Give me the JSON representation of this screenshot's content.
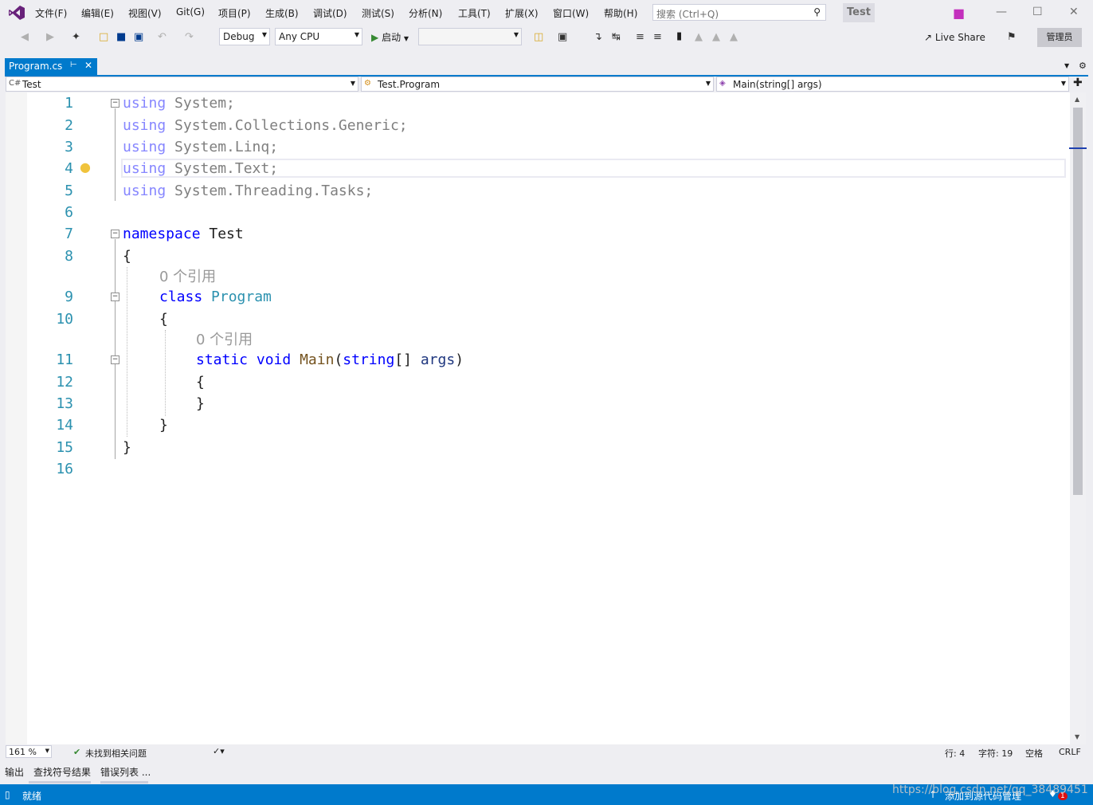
{
  "menu": [
    "文件(F)",
    "编辑(E)",
    "视图(V)",
    "Git(G)",
    "项目(P)",
    "生成(B)",
    "调试(D)",
    "测试(S)",
    "分析(N)",
    "工具(T)",
    "扩展(X)",
    "窗口(W)",
    "帮助(H)"
  ],
  "search": {
    "placeholder": "搜索 (Ctrl+Q)"
  },
  "solution_name": "Test",
  "toolbar": {
    "config": "Debug",
    "platform": "Any CPU",
    "start_label": "启动",
    "live_share": "Live Share",
    "admin": "管理员"
  },
  "tab": {
    "label": "Program.cs"
  },
  "navbar": {
    "project": "Test",
    "type": "Test.Program",
    "member": "Main(string[] args)"
  },
  "editor": {
    "line_numbers": [
      "1",
      "2",
      "3",
      "4",
      "5",
      "6",
      "7",
      "8",
      "9",
      "10",
      "11",
      "12",
      "13",
      "14",
      "15",
      "16"
    ],
    "lines": {
      "l1_kw": "using",
      "l1_rest": " System;",
      "l2_kw": "using",
      "l2_rest": " System.Collections.Generic;",
      "l3_kw": "using",
      "l3_rest": " System.Linq;",
      "l4_kw": "using",
      "l4_rest": " System.Text;",
      "l5_kw": "using",
      "l5_rest": " System.Threading.Tasks;",
      "l7_kw": "namespace",
      "l7_rest": " Test",
      "l8": "{",
      "ref1": "0 个引用",
      "l9_kw": "class",
      "l9_type": "Program",
      "l10": "{",
      "ref2": "0 个引用",
      "l11_kw1": "static",
      "l11_kw2": "void",
      "l11_meth": "Main",
      "l11_p1": "(",
      "l11_kw3": "string",
      "l11_p2": "[] ",
      "l11_arg": "args",
      "l11_p3": ")",
      "l12": "{",
      "l13": "}",
      "l14": "}",
      "l15": "}"
    }
  },
  "editor_status": {
    "zoom": "161 %",
    "issues": "未找到相关问题",
    "line": "行: 4",
    "char": "字符: 19",
    "spacing": "空格",
    "eol": "CRLF"
  },
  "bottom_tabs": [
    "输出",
    "查找符号结果",
    "错误列表 ..."
  ],
  "statusbar": {
    "ready": "就绪",
    "source_control": "添加到源代码管理",
    "notifications": "1"
  },
  "watermark": "https://blog.csdn.net/qq_38489451",
  "colors": {
    "accent": "#007acc",
    "keyword": "#0000ff",
    "type": "#2b91af",
    "line_number": "#2b91af"
  }
}
